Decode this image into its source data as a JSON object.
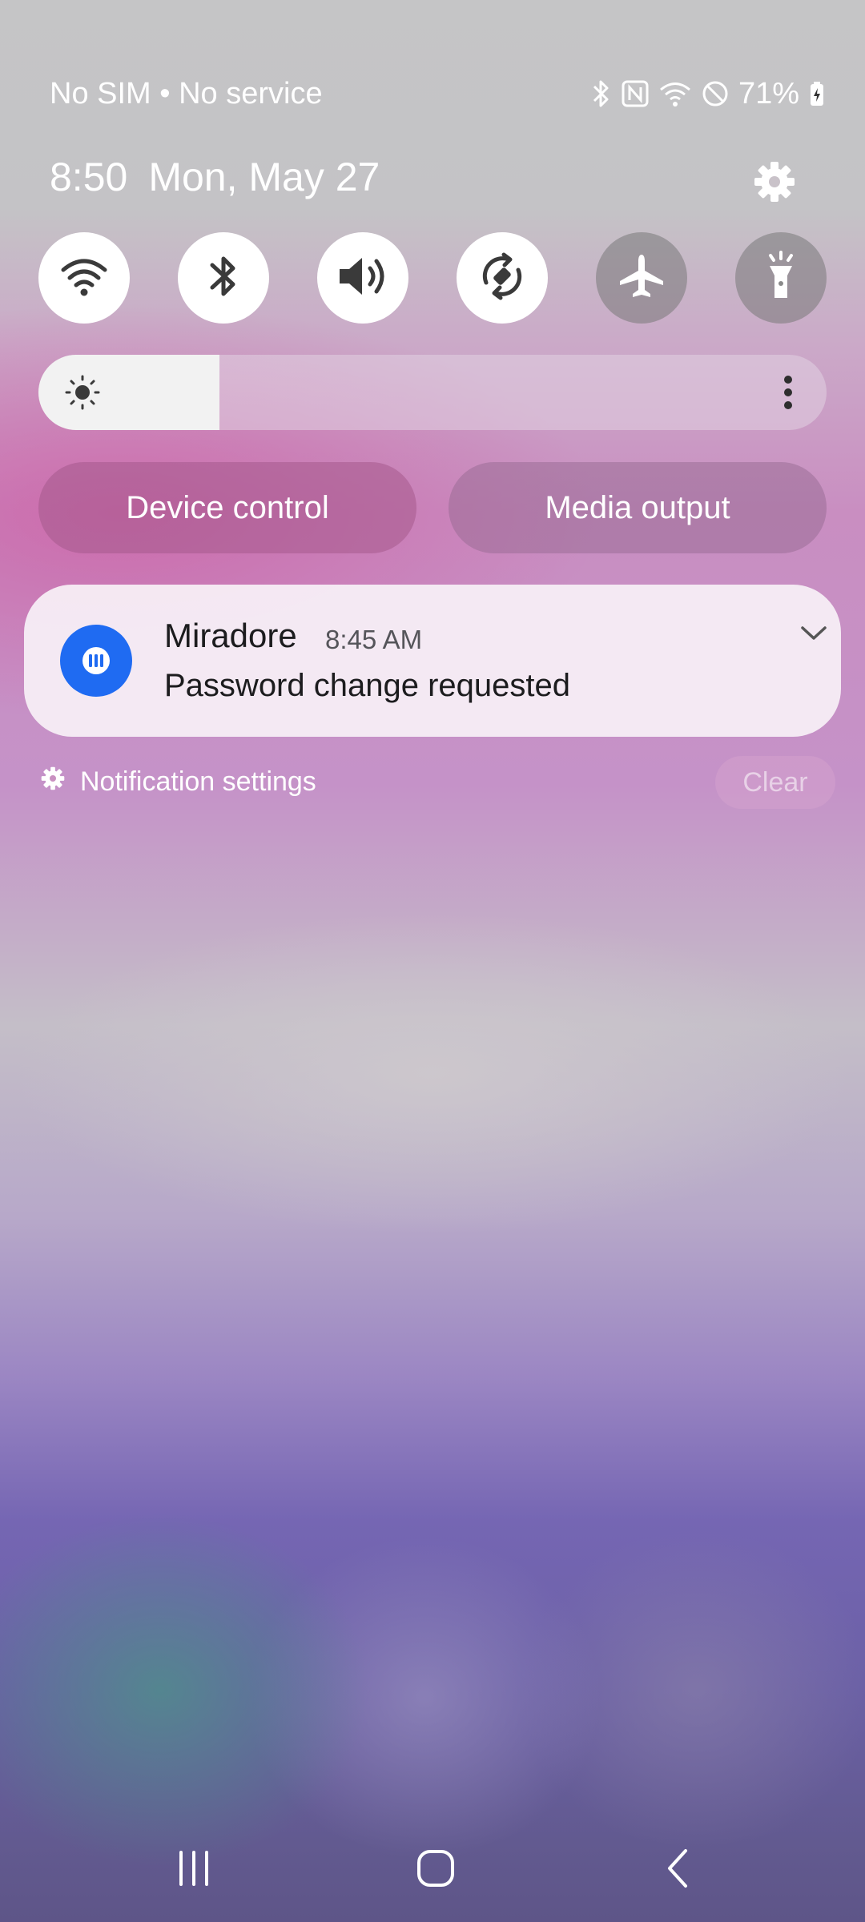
{
  "status_bar": {
    "carrier": "No SIM • No service",
    "battery_percent": "71%",
    "icons": [
      "bluetooth-icon",
      "nfc-icon",
      "wifi-icon",
      "do-not-disturb-icon",
      "battery-charging-icon"
    ]
  },
  "header": {
    "time": "8:50",
    "date": "Mon, May 27"
  },
  "quick_settings": [
    {
      "name": "wifi",
      "icon": "wifi-icon",
      "state": "on"
    },
    {
      "name": "bluetooth",
      "icon": "bluetooth-icon",
      "state": "on"
    },
    {
      "name": "sound",
      "icon": "volume-icon",
      "state": "on"
    },
    {
      "name": "auto-rotate",
      "icon": "rotate-icon",
      "state": "on"
    },
    {
      "name": "airplane-mode",
      "icon": "airplane-icon",
      "state": "off"
    },
    {
      "name": "flashlight",
      "icon": "flashlight-icon",
      "state": "off"
    }
  ],
  "brightness": {
    "level": 0.23
  },
  "buttons": {
    "device_control": "Device control",
    "media_output": "Media output"
  },
  "notification": {
    "app_name": "Miradore",
    "time": "8:45 AM",
    "text": "Password change requested"
  },
  "footer": {
    "notification_settings": "Notification settings",
    "clear": "Clear"
  },
  "colors": {
    "app_icon": "#1f6bf2",
    "toggle_on": "#ffffff",
    "icon_dark": "#3a3a3a"
  }
}
